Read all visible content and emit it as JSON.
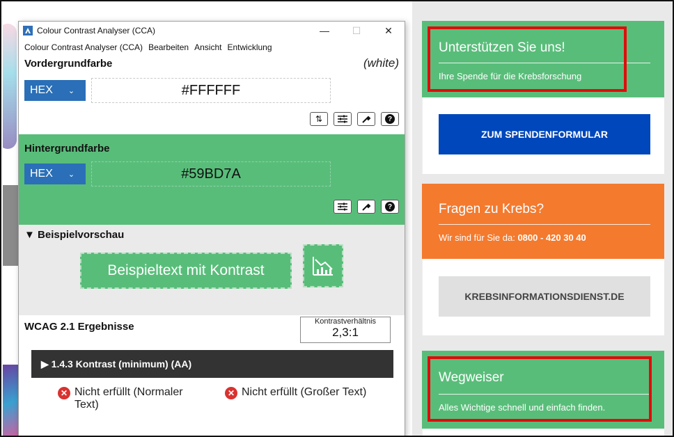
{
  "window": {
    "title": "Colour Contrast Analyser (CCA)",
    "controls": {
      "minimize": "—",
      "maximize": "☐",
      "close": "✕"
    }
  },
  "menu": [
    "Colour Contrast Analyser (CCA)",
    "Bearbeiten",
    "Ansicht",
    "Entwicklung"
  ],
  "foreground": {
    "label": "Vordergrundfarbe",
    "name": "(white)",
    "format": "HEX",
    "value": "#FFFFFF",
    "tools": [
      "⇅",
      "⚙",
      "✎",
      "?"
    ]
  },
  "background": {
    "label": "Hintergrundfarbe",
    "format": "HEX",
    "value": "#59BD7A",
    "tools": [
      "⚙",
      "✎",
      "?"
    ]
  },
  "preview": {
    "header": "▼ Beispielvorschau",
    "sample_text": "Beispieltext mit Kontrast"
  },
  "results": {
    "title": "WCAG 2.1 Ergebnisse",
    "ratio_label": "Kontrastverhältnis",
    "ratio_value": "2,3:1",
    "criterion": "▶ 1.4.3 Kontrast (minimum) (AA)",
    "fail_normal": "Nicht erfüllt (Normaler Text)",
    "fail_large": "Nicht erfüllt (Großer Text)"
  },
  "web": {
    "donate_title": "Unterstützen Sie uns!",
    "donate_sub": "Ihre Spende für die Krebsforschung",
    "donate_button": "ZUM SPENDENFORMULAR",
    "questions_title": "Fragen zu Krebs?",
    "questions_sub_prefix": "Wir sind für Sie da: ",
    "questions_phone": "0800 - 420 30 40",
    "questions_button": "KREBSINFORMATIONSDIENST.DE",
    "guide_title": "Wegweiser",
    "guide_sub": "Alles Wichtige schnell und einfach finden."
  },
  "colors": {
    "green": "#59BD7A",
    "orange": "#F47A2E",
    "blue_button": "#0047BB",
    "highlight_red": "#E20B0B"
  }
}
